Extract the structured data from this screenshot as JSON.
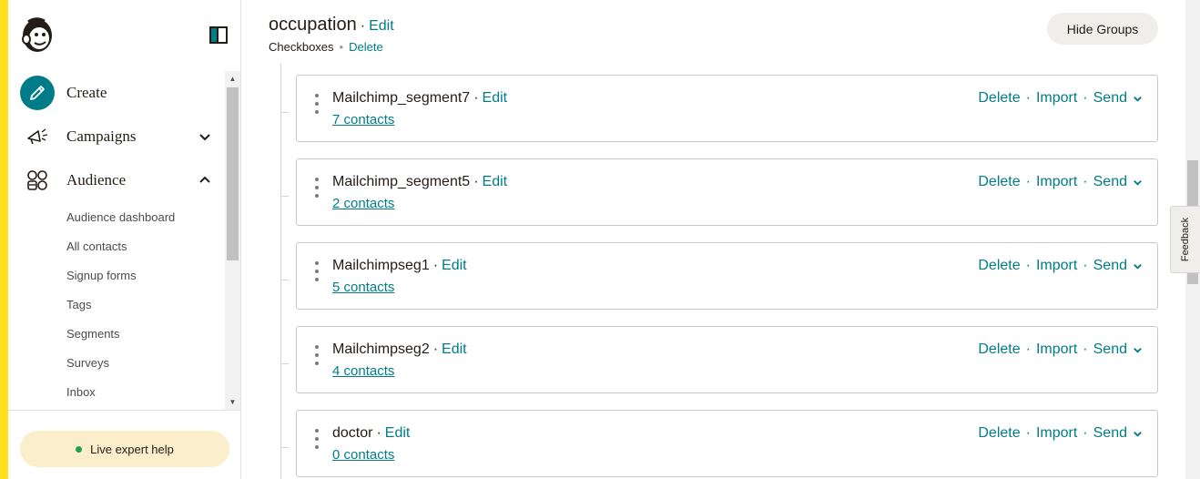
{
  "sidebar": {
    "toggle_icon": "sidebar-toggle-icon",
    "nav": [
      {
        "label": "Create",
        "icon": "pencil-icon"
      },
      {
        "label": "Campaigns",
        "icon": "megaphone-icon"
      },
      {
        "label": "Audience",
        "icon": "audience-icon"
      }
    ],
    "audience_sub": [
      "Audience dashboard",
      "All contacts",
      "Signup forms",
      "Tags",
      "Segments",
      "Surveys",
      "Inbox"
    ],
    "help_label": "Live expert help"
  },
  "group": {
    "title": "occupation",
    "edit_label": "Edit",
    "type_label": "Checkboxes",
    "delete_label": "Delete",
    "hide_groups_label": "Hide Groups"
  },
  "segments": [
    {
      "name": "Mailchimp_segment7",
      "edit": "Edit",
      "contacts": "7 contacts",
      "delete": "Delete",
      "import": "Import",
      "send": "Send"
    },
    {
      "name": "Mailchimp_segment5",
      "edit": "Edit",
      "contacts": "2 contacts",
      "delete": "Delete",
      "import": "Import",
      "send": "Send"
    },
    {
      "name": "Mailchimpseg1",
      "edit": "Edit",
      "contacts": "5 contacts",
      "delete": "Delete",
      "import": "Import",
      "send": "Send"
    },
    {
      "name": "Mailchimpseg2",
      "edit": "Edit",
      "contacts": "4 contacts",
      "delete": "Delete",
      "import": "Import",
      "send": "Send"
    },
    {
      "name": "doctor",
      "edit": "Edit",
      "contacts": "0 contacts",
      "delete": "Delete",
      "import": "Import",
      "send": "Send"
    }
  ],
  "feedback_label": "Feedback",
  "colors": {
    "accent": "#ffe01b",
    "link": "#007c89",
    "create_icon_bg": "#007c89"
  }
}
